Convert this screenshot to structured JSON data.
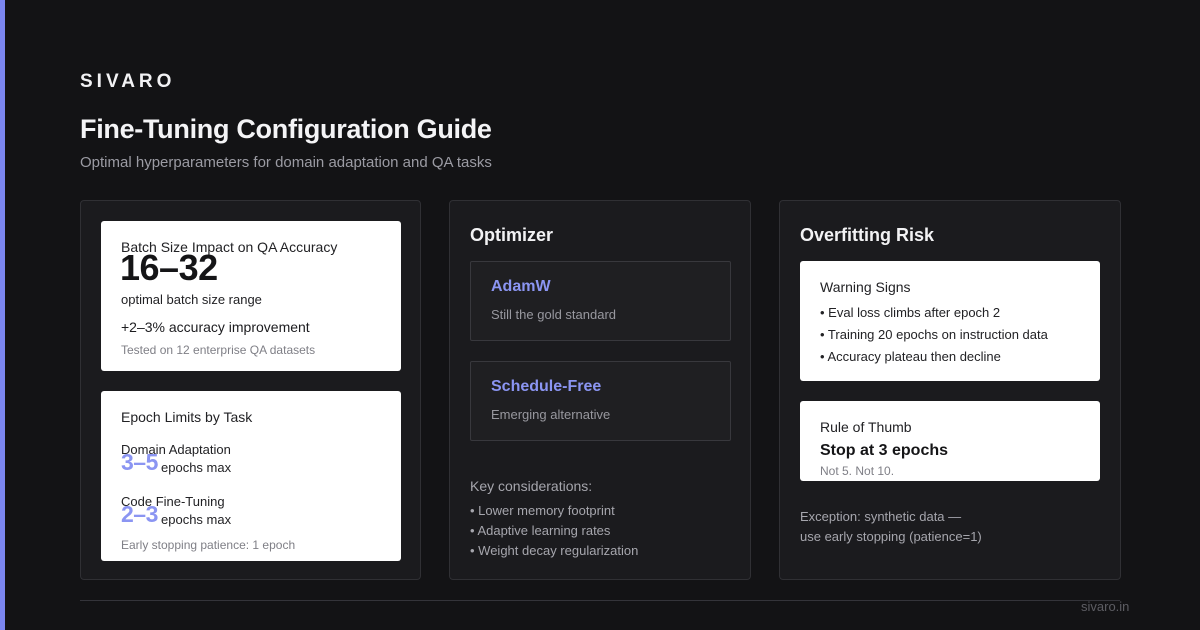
{
  "brand": "SIVARO",
  "title": "Fine-Tuning Configuration Guide",
  "subtitle": "Optimal hyperparameters for domain adaptation and QA tasks",
  "accent_color": "#7b86f0",
  "batch_card": {
    "label": "Batch Size Impact on QA Accuracy",
    "value": "16–32",
    "value_caption": "optimal batch size range",
    "improvement": "+2–3% accuracy improvement",
    "note": "Tested on 12 enterprise QA datasets"
  },
  "epoch_card": {
    "label": "Epoch Limits by Task",
    "tasks": [
      {
        "name": "Domain Adaptation",
        "range": "3–5",
        "unit": "epochs max"
      },
      {
        "name": "Code Fine-Tuning",
        "range": "2–3",
        "unit": "epochs max"
      }
    ],
    "note": "Early stopping patience: 1 epoch"
  },
  "optimizer": {
    "title": "Optimizer",
    "options": [
      {
        "name": "AdamW",
        "desc": "Still the gold standard"
      },
      {
        "name": "Schedule-Free",
        "desc": "Emerging alternative"
      }
    ],
    "considerations_label": "Key considerations:",
    "considerations": [
      "• Lower memory footprint",
      "• Adaptive learning rates",
      "• Weight decay regularization"
    ]
  },
  "overfitting": {
    "title": "Overfitting Risk",
    "warning_label": "Warning Signs",
    "warnings": [
      "• Eval loss climbs after epoch 2",
      "• Training 20 epochs on instruction data",
      "• Accuracy plateau then decline"
    ],
    "rule_label": "Rule of Thumb",
    "rule_value": "Stop at 3 epochs",
    "rule_note": "Not 5. Not 10.",
    "exception_line1": "Exception: synthetic data —",
    "exception_line2": "use early stopping (patience=1)"
  },
  "footer_url": "sivaro.in"
}
